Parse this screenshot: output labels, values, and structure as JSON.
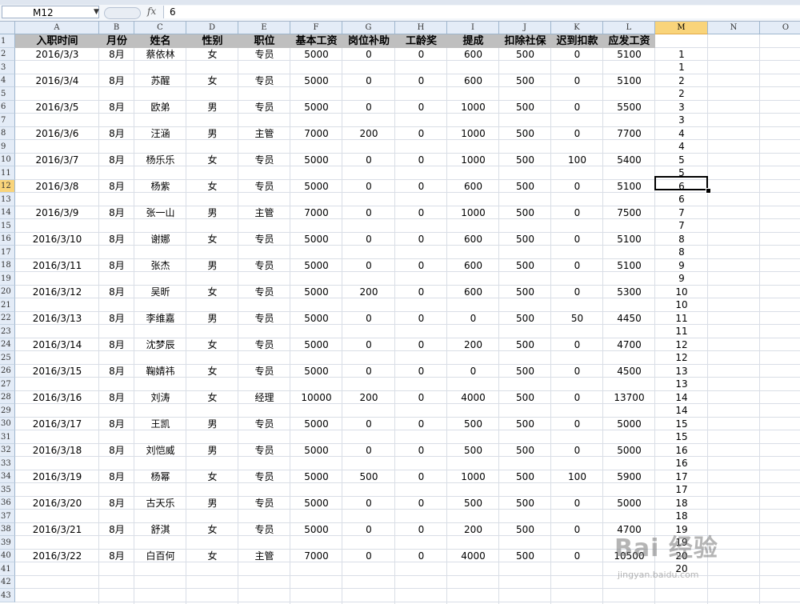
{
  "formula_bar": {
    "name_box": "M12",
    "fx_label": "fx",
    "formula": "6"
  },
  "columns": [
    "A",
    "B",
    "C",
    "D",
    "E",
    "F",
    "G",
    "H",
    "I",
    "J",
    "K",
    "L",
    "M",
    "N",
    "O"
  ],
  "selected_column": "M",
  "selected_row": "12",
  "row_numbers": [
    "1",
    "2",
    "3",
    "4",
    "5",
    "6",
    "7",
    "8",
    "9",
    "10",
    "11",
    "12",
    "13",
    "14",
    "15",
    "16",
    "17",
    "18",
    "19",
    "20",
    "21",
    "22",
    "23",
    "24",
    "25",
    "26",
    "27",
    "28",
    "29",
    "30",
    "31",
    "32",
    "33",
    "34",
    "35",
    "36",
    "37",
    "38",
    "39",
    "40",
    "41",
    "42",
    "43"
  ],
  "headers": [
    "入职时间",
    "月份",
    "姓名",
    "性别",
    "职位",
    "基本工资",
    "岗位补助",
    "工龄奖",
    "提成",
    "扣除社保",
    "迟到扣款",
    "应发工资"
  ],
  "records": [
    [
      "2016/3/3",
      "8月",
      "蔡依林",
      "女",
      "专员",
      "5000",
      "0",
      "0",
      "600",
      "500",
      "0",
      "5100"
    ],
    [
      "2016/3/4",
      "8月",
      "苏醒",
      "女",
      "专员",
      "5000",
      "0",
      "0",
      "600",
      "500",
      "0",
      "5100"
    ],
    [
      "2016/3/5",
      "8月",
      "欧弟",
      "男",
      "专员",
      "5000",
      "0",
      "0",
      "1000",
      "500",
      "0",
      "5500"
    ],
    [
      "2016/3/6",
      "8月",
      "汪涵",
      "男",
      "主管",
      "7000",
      "200",
      "0",
      "1000",
      "500",
      "0",
      "7700"
    ],
    [
      "2016/3/7",
      "8月",
      "杨乐乐",
      "女",
      "专员",
      "5000",
      "0",
      "0",
      "1000",
      "500",
      "100",
      "5400"
    ],
    [
      "2016/3/8",
      "8月",
      "杨紫",
      "女",
      "专员",
      "5000",
      "0",
      "0",
      "600",
      "500",
      "0",
      "5100"
    ],
    [
      "2016/3/9",
      "8月",
      "张一山",
      "男",
      "主管",
      "7000",
      "0",
      "0",
      "1000",
      "500",
      "0",
      "7500"
    ],
    [
      "2016/3/10",
      "8月",
      "谢娜",
      "女",
      "专员",
      "5000",
      "0",
      "0",
      "600",
      "500",
      "0",
      "5100"
    ],
    [
      "2016/3/11",
      "8月",
      "张杰",
      "男",
      "专员",
      "5000",
      "0",
      "0",
      "600",
      "500",
      "0",
      "5100"
    ],
    [
      "2016/3/12",
      "8月",
      "吴昕",
      "女",
      "专员",
      "5000",
      "200",
      "0",
      "600",
      "500",
      "0",
      "5300"
    ],
    [
      "2016/3/13",
      "8月",
      "李维嘉",
      "男",
      "专员",
      "5000",
      "0",
      "0",
      "0",
      "500",
      "50",
      "4450"
    ],
    [
      "2016/3/14",
      "8月",
      "沈梦辰",
      "女",
      "专员",
      "5000",
      "0",
      "0",
      "200",
      "500",
      "0",
      "4700"
    ],
    [
      "2016/3/15",
      "8月",
      "鞠婧祎",
      "女",
      "专员",
      "5000",
      "0",
      "0",
      "0",
      "500",
      "0",
      "4500"
    ],
    [
      "2016/3/16",
      "8月",
      "刘涛",
      "女",
      "经理",
      "10000",
      "200",
      "0",
      "4000",
      "500",
      "0",
      "13700"
    ],
    [
      "2016/3/17",
      "8月",
      "王凯",
      "男",
      "专员",
      "5000",
      "0",
      "0",
      "500",
      "500",
      "0",
      "5000"
    ],
    [
      "2016/3/18",
      "8月",
      "刘恺威",
      "男",
      "专员",
      "5000",
      "0",
      "0",
      "500",
      "500",
      "0",
      "5000"
    ],
    [
      "2016/3/19",
      "8月",
      "杨幂",
      "女",
      "专员",
      "5000",
      "500",
      "0",
      "1000",
      "500",
      "100",
      "5900"
    ],
    [
      "2016/3/20",
      "8月",
      "古天乐",
      "男",
      "专员",
      "5000",
      "0",
      "0",
      "500",
      "500",
      "0",
      "5000"
    ],
    [
      "2016/3/21",
      "8月",
      "舒淇",
      "女",
      "专员",
      "5000",
      "0",
      "0",
      "200",
      "500",
      "0",
      "4700"
    ],
    [
      "2016/3/22",
      "8月",
      "白百何",
      "女",
      "主管",
      "7000",
      "0",
      "0",
      "4000",
      "500",
      "0",
      "10500"
    ]
  ],
  "helper_column_m": [
    "1",
    "1",
    "2",
    "2",
    "3",
    "3",
    "4",
    "4",
    "5",
    "5",
    "6",
    "6",
    "7",
    "7",
    "8",
    "8",
    "9",
    "9",
    "10",
    "10",
    "11",
    "11",
    "12",
    "12",
    "13",
    "13",
    "14",
    "14",
    "15",
    "15",
    "16",
    "16",
    "17",
    "17",
    "18",
    "18",
    "19",
    "19",
    "20",
    "20"
  ],
  "watermark": {
    "logo": "Bai 经验",
    "url": "jingyan.baidu.com"
  },
  "colors": {
    "header_fill": "#bfbfbf",
    "selection_fill": "#f9d47a",
    "header_bar": "#e4ecf7"
  }
}
